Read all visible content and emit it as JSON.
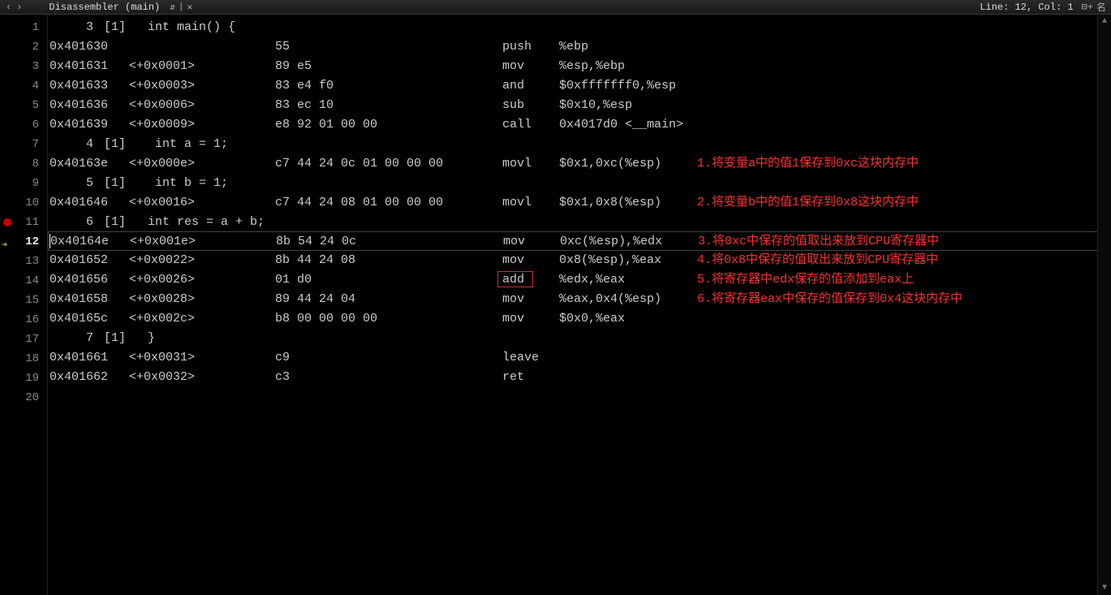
{
  "titlebar": {
    "nav_back": "‹",
    "nav_fwd": "›",
    "tab_label": "Disassembler (main)",
    "updown": "⇵",
    "divider": "|",
    "close": "✕",
    "status": "Line: 12, Col: 1",
    "icon1": "⊟+",
    "icon2": "名"
  },
  "lines": [
    {
      "n": "1",
      "pre": "3",
      "offset": "[1]",
      "src": "   int main() {"
    },
    {
      "n": "2",
      "addr": "0x401630",
      "offset": "",
      "hex": "55",
      "mnem": "push",
      "ops": "%ebp"
    },
    {
      "n": "3",
      "addr": "0x401631",
      "offset": "<+0x0001>",
      "hex": "89 e5",
      "mnem": "mov",
      "ops": "%esp,%ebp"
    },
    {
      "n": "4",
      "addr": "0x401633",
      "offset": "<+0x0003>",
      "hex": "83 e4 f0",
      "mnem": "and",
      "ops": "$0xfffffff0,%esp"
    },
    {
      "n": "5",
      "addr": "0x401636",
      "offset": "<+0x0006>",
      "hex": "83 ec 10",
      "mnem": "sub",
      "ops": "$0x10,%esp"
    },
    {
      "n": "6",
      "addr": "0x401639",
      "offset": "<+0x0009>",
      "hex": "e8 92 01 00 00",
      "mnem": "call",
      "ops": "0x4017d0 <__main>"
    },
    {
      "n": "7",
      "pre": "4",
      "offset": "[1]",
      "src": "    int a = 1;"
    },
    {
      "n": "8",
      "addr": "0x40163e",
      "offset": "<+0x000e>",
      "hex": "c7 44 24 0c 01 00 00 00",
      "mnem": "movl",
      "ops": "$0x1,0xc(%esp)",
      "ann": "1.将变量a中的值1保存到0xc这块内存中"
    },
    {
      "n": "9",
      "pre": "5",
      "offset": "[1]",
      "src": "    int b = 1;"
    },
    {
      "n": "10",
      "addr": "0x401646",
      "offset": "<+0x0016>",
      "hex": "c7 44 24 08 01 00 00 00",
      "mnem": "movl",
      "ops": "$0x1,0x8(%esp)",
      "ann": "2.将变量b中的值1保存到0x8这块内存中"
    },
    {
      "n": "11",
      "pre": "6",
      "offset": "[1]",
      "src": "   int res = a + b;",
      "bp": true
    },
    {
      "n": "12",
      "addr": "0x40164e",
      "offset": "<+0x001e>",
      "hex": "8b 54 24 0c",
      "mnem": "mov",
      "ops": "0xc(%esp),%edx",
      "ann": "3.将0xc中保存的值取出来放到CPU寄存器中",
      "current": true,
      "arrow": true
    },
    {
      "n": "13",
      "addr": "0x401652",
      "offset": "<+0x0022>",
      "hex": "8b 44 24 08",
      "mnem": "mov",
      "ops": "0x8(%esp),%eax",
      "ann": "4.将0x8中保存的值取出来放到CPU寄存器中"
    },
    {
      "n": "14",
      "addr": "0x401656",
      "offset": "<+0x0026>",
      "hex": "01 d0",
      "mnem": "add",
      "ops": "%edx,%eax",
      "ann": "5.将寄存器中edx保存的值添加到eax上",
      "mnembox": true
    },
    {
      "n": "15",
      "addr": "0x401658",
      "offset": "<+0x0028>",
      "hex": "89 44 24 04",
      "mnem": "mov",
      "ops": "%eax,0x4(%esp)",
      "ann": "6.将寄存器eax中保存的值保存到0x4这块内存中"
    },
    {
      "n": "16",
      "addr": "0x40165c",
      "offset": "<+0x002c>",
      "hex": "b8 00 00 00 00",
      "mnem": "mov",
      "ops": "$0x0,%eax"
    },
    {
      "n": "17",
      "pre": "7",
      "offset": "[1]",
      "src": "   }"
    },
    {
      "n": "18",
      "addr": "0x401661",
      "offset": "<+0x0031>",
      "hex": "c9",
      "mnem": "leave",
      "ops": ""
    },
    {
      "n": "19",
      "addr": "0x401662",
      "offset": "<+0x0032>",
      "hex": "c3",
      "mnem": "ret",
      "ops": ""
    },
    {
      "n": "20"
    }
  ]
}
